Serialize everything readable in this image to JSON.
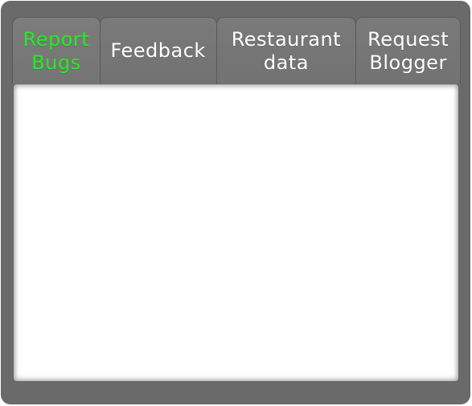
{
  "tabs": [
    {
      "label": "Report\nBugs",
      "active": true
    },
    {
      "label": "Feedback",
      "active": false
    },
    {
      "label": "Restaurant\ndata",
      "active": false
    },
    {
      "label": "Request\nBlogger",
      "active": false
    }
  ],
  "colors": {
    "panel": "#6a6a6a",
    "tab": "#767676",
    "active_tab_text": "#22ee22",
    "tab_text": "#ffffff",
    "content_background": "#ffffff"
  }
}
